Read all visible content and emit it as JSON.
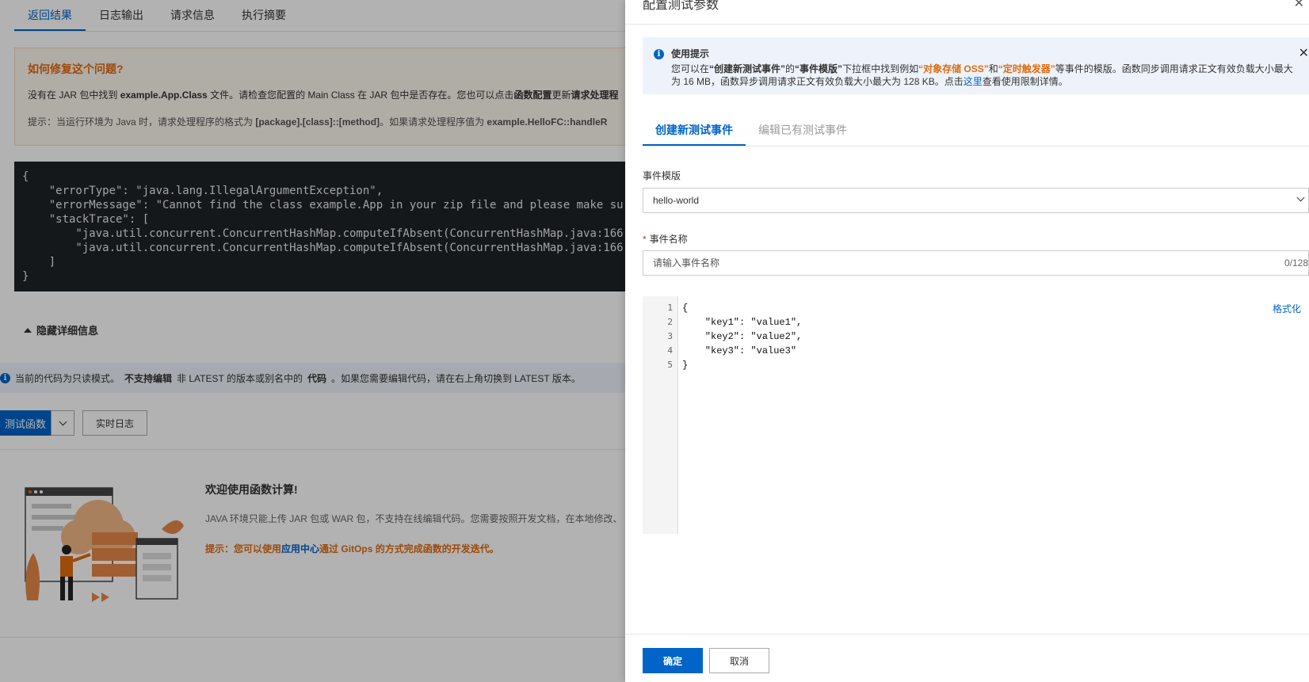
{
  "background": {
    "tabs": [
      "返回结果",
      "日志输出",
      "请求信息",
      "执行摘要"
    ],
    "fix": {
      "title": "如何修复这个问题?",
      "p1_a": "没有在 JAR 包中找到 ",
      "p1_class": "example.App.Class",
      "p1_b": " 文件。请检查您配置的 Main Class 在 JAR 包中是否存在。您也可以点击",
      "p1_link": "函数配置",
      "p1_c": "更新",
      "p1_d": "请求处理程",
      "hint_a": "提示：当运行环境为 Java 时，请求处理程序的格式为 ",
      "hint_fmt": "[package].[class]::[method]",
      "hint_b": "。如果请求处理程序值为 ",
      "hint_val": "example.HelloFC::handleR"
    },
    "code": "{\n    \"errorType\": \"java.lang.IllegalArgumentException\",\n    \"errorMessage\": \"Cannot find the class example.App in your zip file and please make su\n    \"stackTrace\": [\n        \"java.util.concurrent.ConcurrentHashMap.computeIfAbsent(ConcurrentHashMap.java:166\n        \"java.util.concurrent.ConcurrentHashMap.computeIfAbsent(ConcurrentHashMap.java:166\n    ]\n}",
    "hide_detail": "隐藏详细信息",
    "readonly_a": "当前的代码为只读模式。",
    "readonly_b": "不支持编辑",
    "readonly_c": "非 LATEST 的版本或别名中的",
    "readonly_d": "代码",
    "readonly_e": "。如果您需要编辑代码，请在右上角切换到 LATEST 版本。",
    "test_button": "测试函数",
    "log_button": "实时日志",
    "welcome_title": "欢迎使用函数计算!",
    "welcome_desc": "JAVA 环境只能上传 JAR 包或 WAR 包，不支持在线编辑代码。您需要按照开发文档，在本地修改、",
    "welcome_tip_a": "提示：您可以使用",
    "welcome_tip_link": "应用中心",
    "welcome_tip_b": "通过 GitOps 的方式完成函数的开发迭代。"
  },
  "drawer": {
    "title": "配置测试参数",
    "tip_title": "使用提示",
    "tip_a": "您可以在",
    "tip_q1": "“创建新测试事件”",
    "tip_b": "的",
    "tip_q2": "“事件模版”",
    "tip_c": "下拉框中找到例如",
    "tip_h1": "“对象存储 OSS”",
    "tip_d": "和",
    "tip_h2": "“定时触发器”",
    "tip_e": "等事件的模版。函数同步调用请求正文有效负载大小最大为 16 MB，函数异步调用请求正文有效负载大小最大为 128 KB。点击",
    "tip_link": "这里",
    "tip_f": "查看使用限制详情。",
    "tabs": [
      "创建新测试事件",
      "编辑已有测试事件"
    ],
    "template_label": "事件模版",
    "template_value": "hello-world",
    "name_label": "事件名称",
    "name_required": "*",
    "name_placeholder": "请输入事件名称",
    "name_count": "0/128",
    "format_link": "格式化",
    "line_numbers": "1\n2\n3\n4\n5",
    "event_code": "{\n    \"key1\": \"value1\",\n    \"key2\": \"value2\",\n    \"key3\": \"value3\"\n}",
    "ok_button": "确定",
    "cancel_button": "取消"
  },
  "colors": {
    "primary": "#0064c8",
    "warning": "#e06c11",
    "code_bg": "#1f2328"
  }
}
